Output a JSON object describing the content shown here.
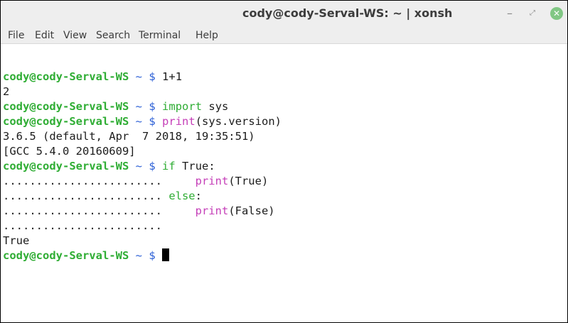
{
  "window": {
    "title": "cody@cody-Serval-WS: ~ | xonsh",
    "minimize_glyph": "–",
    "maximize_glyph": "⤢",
    "close_glyph": "✕",
    "close_color": "#81c784"
  },
  "menu": [
    "File",
    "Edit",
    "View",
    "Search",
    "Terminal",
    "Help"
  ],
  "terminal": {
    "prompt": {
      "user": "cody@cody-Serval-WS",
      "tilde": "~",
      "dollar": "$"
    },
    "colors": {
      "prompt_user": "#2fad34",
      "prompt_symbols": "#2b5fd6",
      "keyword": "#2fad34",
      "function": "#c53fb8"
    },
    "lines": [
      {
        "type": "prompt",
        "segments": [
          {
            "t": "1+1",
            "c": ""
          }
        ]
      },
      {
        "type": "output",
        "text": "2"
      },
      {
        "type": "prompt",
        "segments": [
          {
            "t": "import",
            "c": "kw"
          },
          {
            "t": " sys",
            "c": ""
          }
        ]
      },
      {
        "type": "prompt",
        "segments": [
          {
            "t": "print",
            "c": "fn"
          },
          {
            "t": "(sys.version)",
            "c": ""
          }
        ]
      },
      {
        "type": "output",
        "text": "3.6.5 (default, Apr  7 2018, 19:35:51)"
      },
      {
        "type": "output",
        "text": "[GCC 5.4.0 20160609]"
      },
      {
        "type": "prompt",
        "segments": [
          {
            "t": "if",
            "c": "kw"
          },
          {
            "t": " True:",
            "c": ""
          }
        ]
      },
      {
        "type": "continuation",
        "dots": "........................",
        "segments": [
          {
            "t": "    ",
            "c": ""
          },
          {
            "t": "print",
            "c": "fn"
          },
          {
            "t": "(True)",
            "c": ""
          }
        ]
      },
      {
        "type": "continuation",
        "dots": "........................",
        "segments": [
          {
            "t": "else",
            "c": "kw"
          },
          {
            "t": ":",
            "c": ""
          }
        ]
      },
      {
        "type": "continuation",
        "dots": "........................",
        "segments": [
          {
            "t": "    ",
            "c": ""
          },
          {
            "t": "print",
            "c": "fn"
          },
          {
            "t": "(False)",
            "c": ""
          }
        ]
      },
      {
        "type": "continuation",
        "dots": "........................",
        "segments": []
      },
      {
        "type": "output",
        "text": "True"
      },
      {
        "type": "prompt",
        "segments": [],
        "cursor": true
      }
    ]
  }
}
